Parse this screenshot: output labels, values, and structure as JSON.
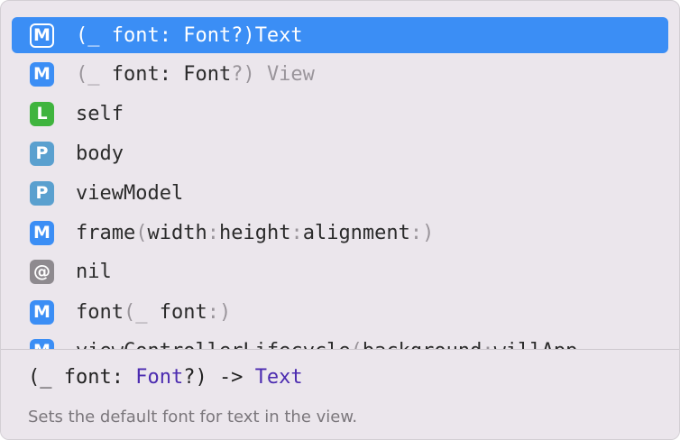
{
  "colors": {
    "method_badge": "#3b8ef5",
    "local_badge": "#3fb43e",
    "property_badge": "#5aa0cf",
    "keyword_badge": "#8e8a8f",
    "selection": "#3b8ef5",
    "type_highlight": "#4b2bb0"
  },
  "completions": [
    {
      "badge": "M",
      "kind": "method",
      "parts": [
        "(_ font: Font?) ",
        "Text"
      ]
    },
    {
      "badge": "M",
      "kind": "method",
      "parts": [
        "(_ font: Font",
        "?) View"
      ]
    },
    {
      "badge": "L",
      "kind": "local",
      "parts": [
        "self"
      ]
    },
    {
      "badge": "P",
      "kind": "property",
      "parts": [
        "body"
      ]
    },
    {
      "badge": "P",
      "kind": "property",
      "parts": [
        "viewModel"
      ]
    },
    {
      "badge": "M",
      "kind": "method",
      "parts": [
        "frame",
        "(",
        "width",
        ":",
        "height",
        ":",
        "alignment",
        ":)"
      ]
    },
    {
      "badge": "@",
      "kind": "keyword",
      "parts": [
        "nil"
      ]
    },
    {
      "badge": "M",
      "kind": "method",
      "parts": [
        "font",
        "(_ ",
        "font",
        ":)"
      ]
    },
    {
      "badge": "M",
      "kind": "method",
      "parts": [
        "viewControllerLifecycle",
        "(",
        "background",
        ":",
        "willApp"
      ]
    }
  ],
  "detail": {
    "sig_open": "(_ font: ",
    "sig_type": "Font",
    "sig_mid": "?) -> ",
    "sig_return": "Text",
    "description": "Sets the default font for text in the view."
  }
}
